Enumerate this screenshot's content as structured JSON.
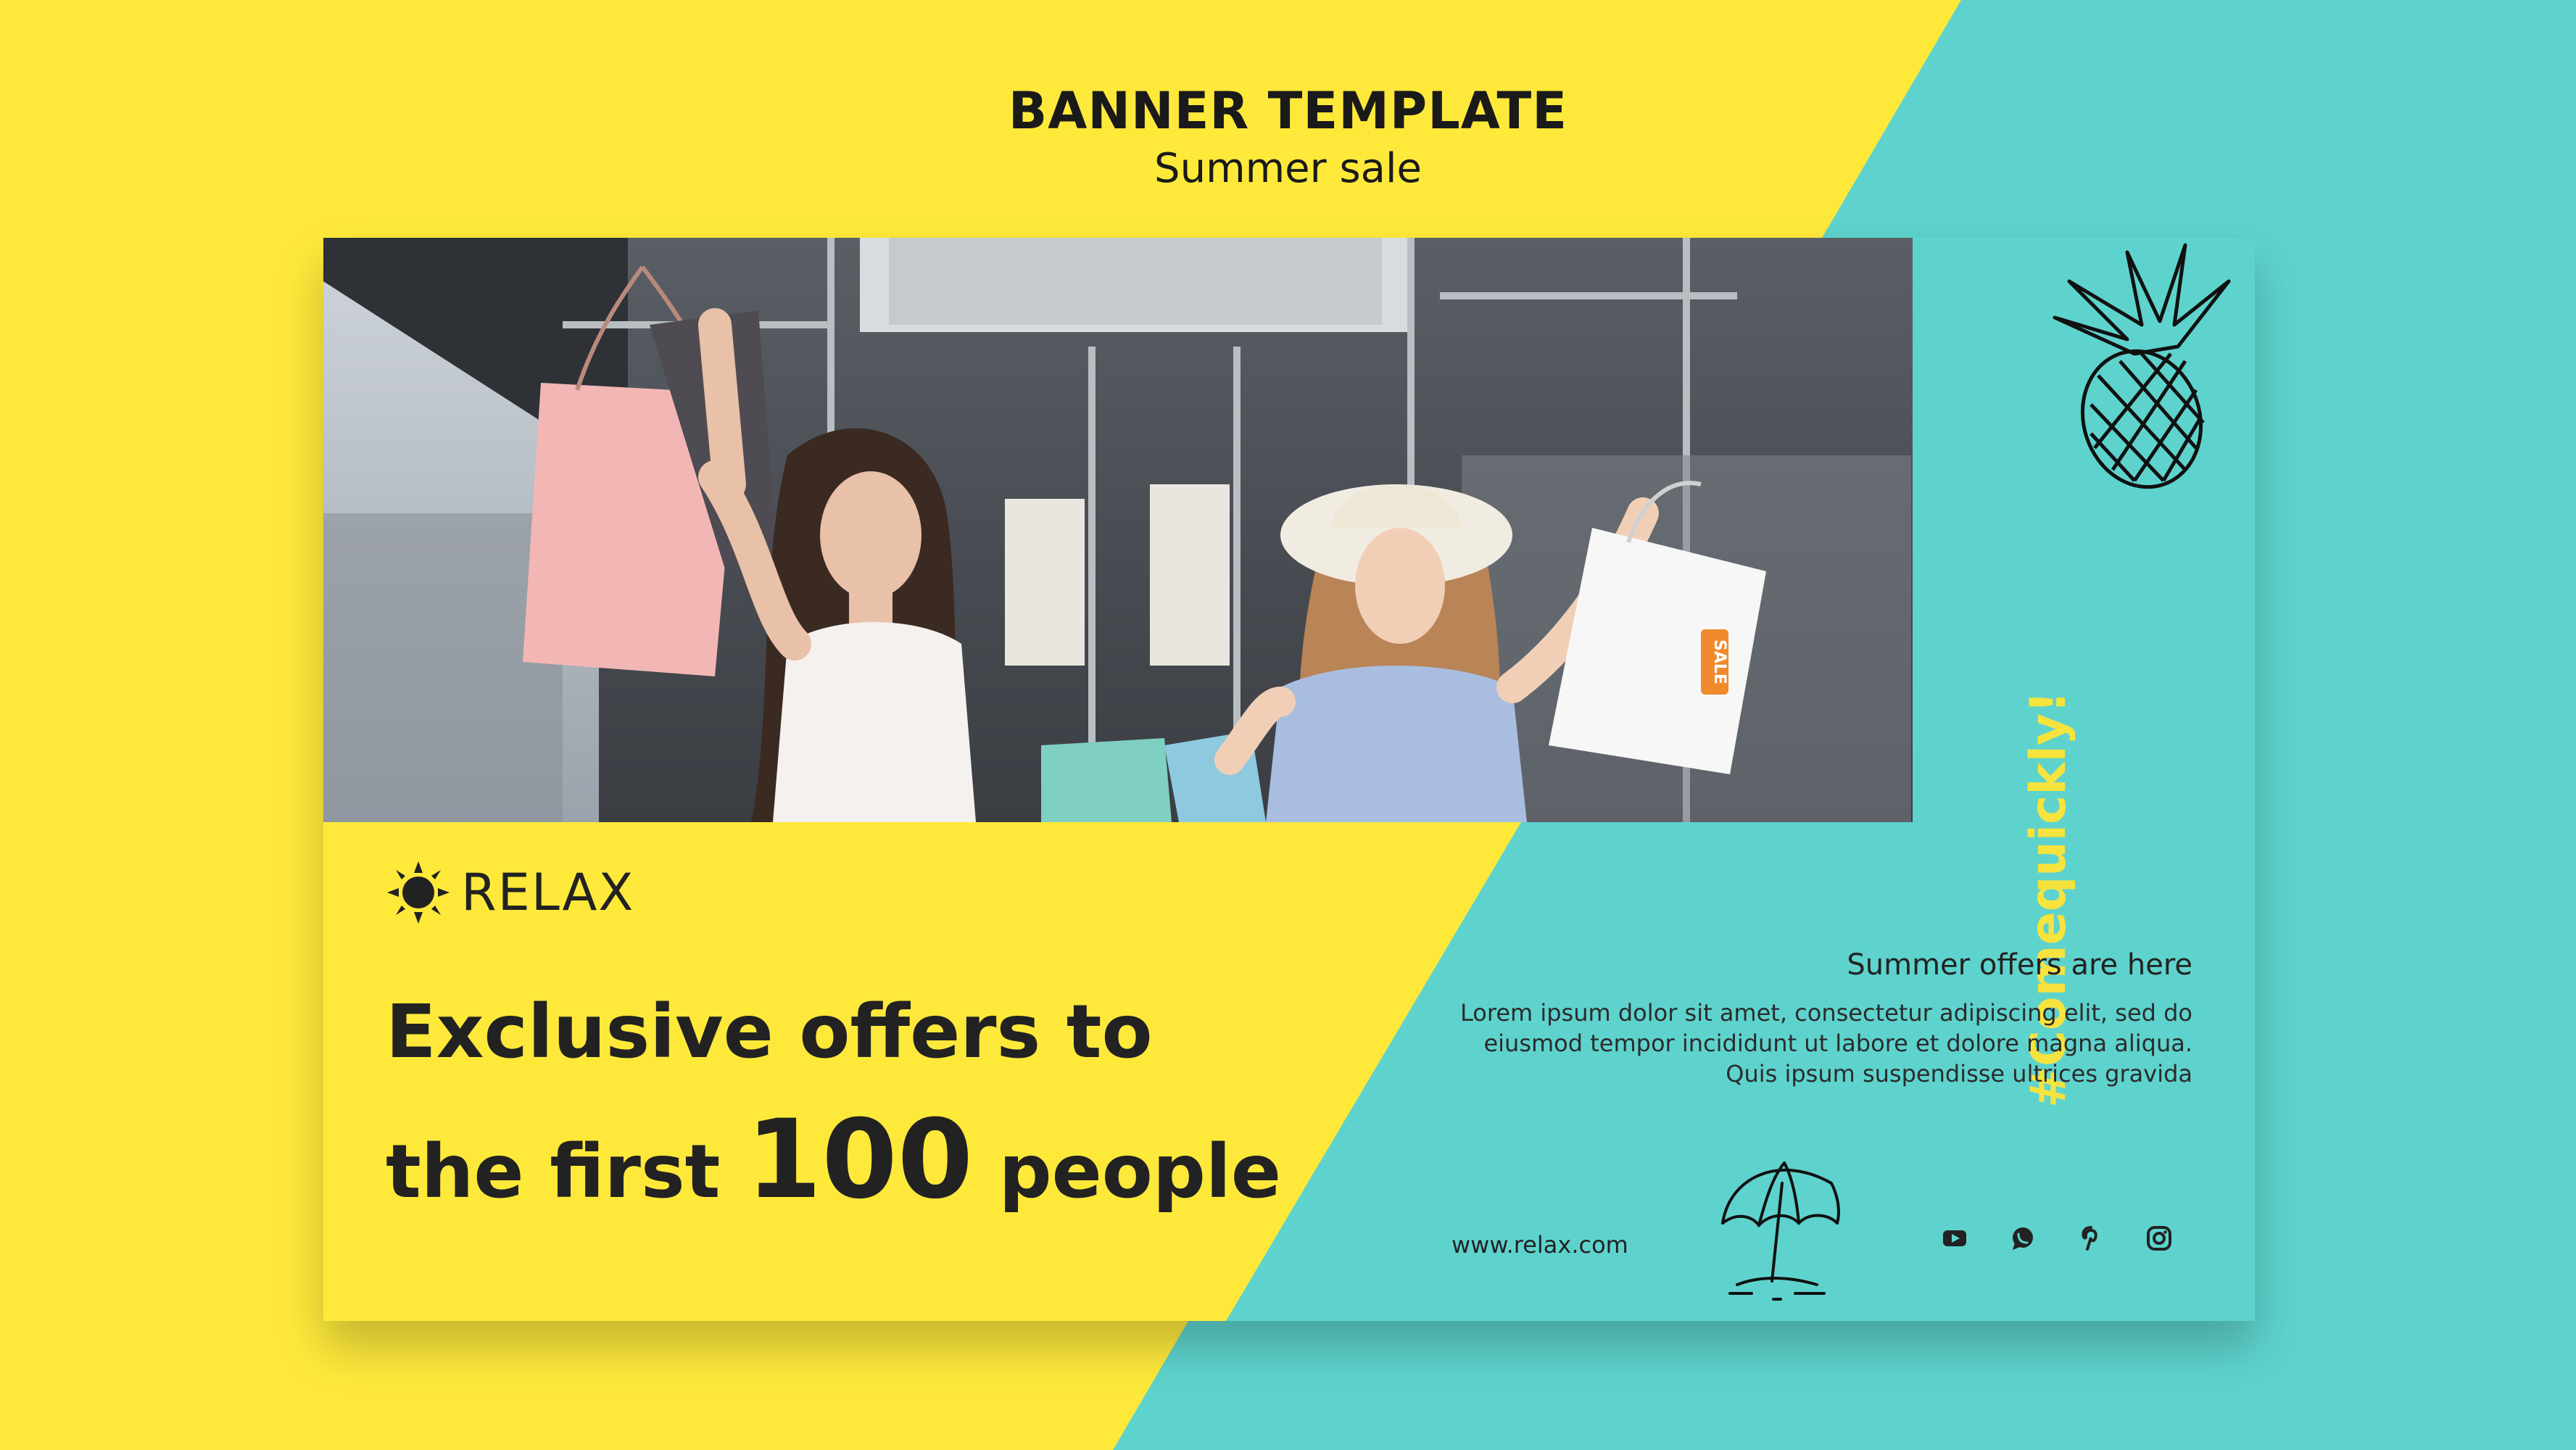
{
  "colors": {
    "yellow": "#fee93b",
    "teal": "#5ed3cd",
    "dark": "#222222",
    "accent_yellow": "#f6e33e",
    "sale_tag": "#f08a2c"
  },
  "header": {
    "title": "BANNER TEMPLATE",
    "subtitle": "Summer sale"
  },
  "banner": {
    "logo": {
      "icon": "sun-icon",
      "text": "RELAX"
    },
    "headline": {
      "line1": "Exclusive offers to",
      "line2_prefix": "the first",
      "line2_number": "100",
      "line2_suffix": "people"
    },
    "vertical_tag": "#Comequickly!",
    "offers_title": "Summer offers are here",
    "offers_body": "Lorem ipsum dolor sit amet, consectetur adipiscing elit, sed do eiusmod tempor incididunt ut labore et dolore magna aliqua. Quis ipsum suspendisse ultrices gravida",
    "website": "www.relax.com",
    "photo_sale_tag": "SALE",
    "decorations": [
      "pineapple-icon",
      "beach-umbrella-icon"
    ],
    "socials": [
      "youtube-icon",
      "whatsapp-icon",
      "pinterest-icon",
      "instagram-icon"
    ]
  }
}
